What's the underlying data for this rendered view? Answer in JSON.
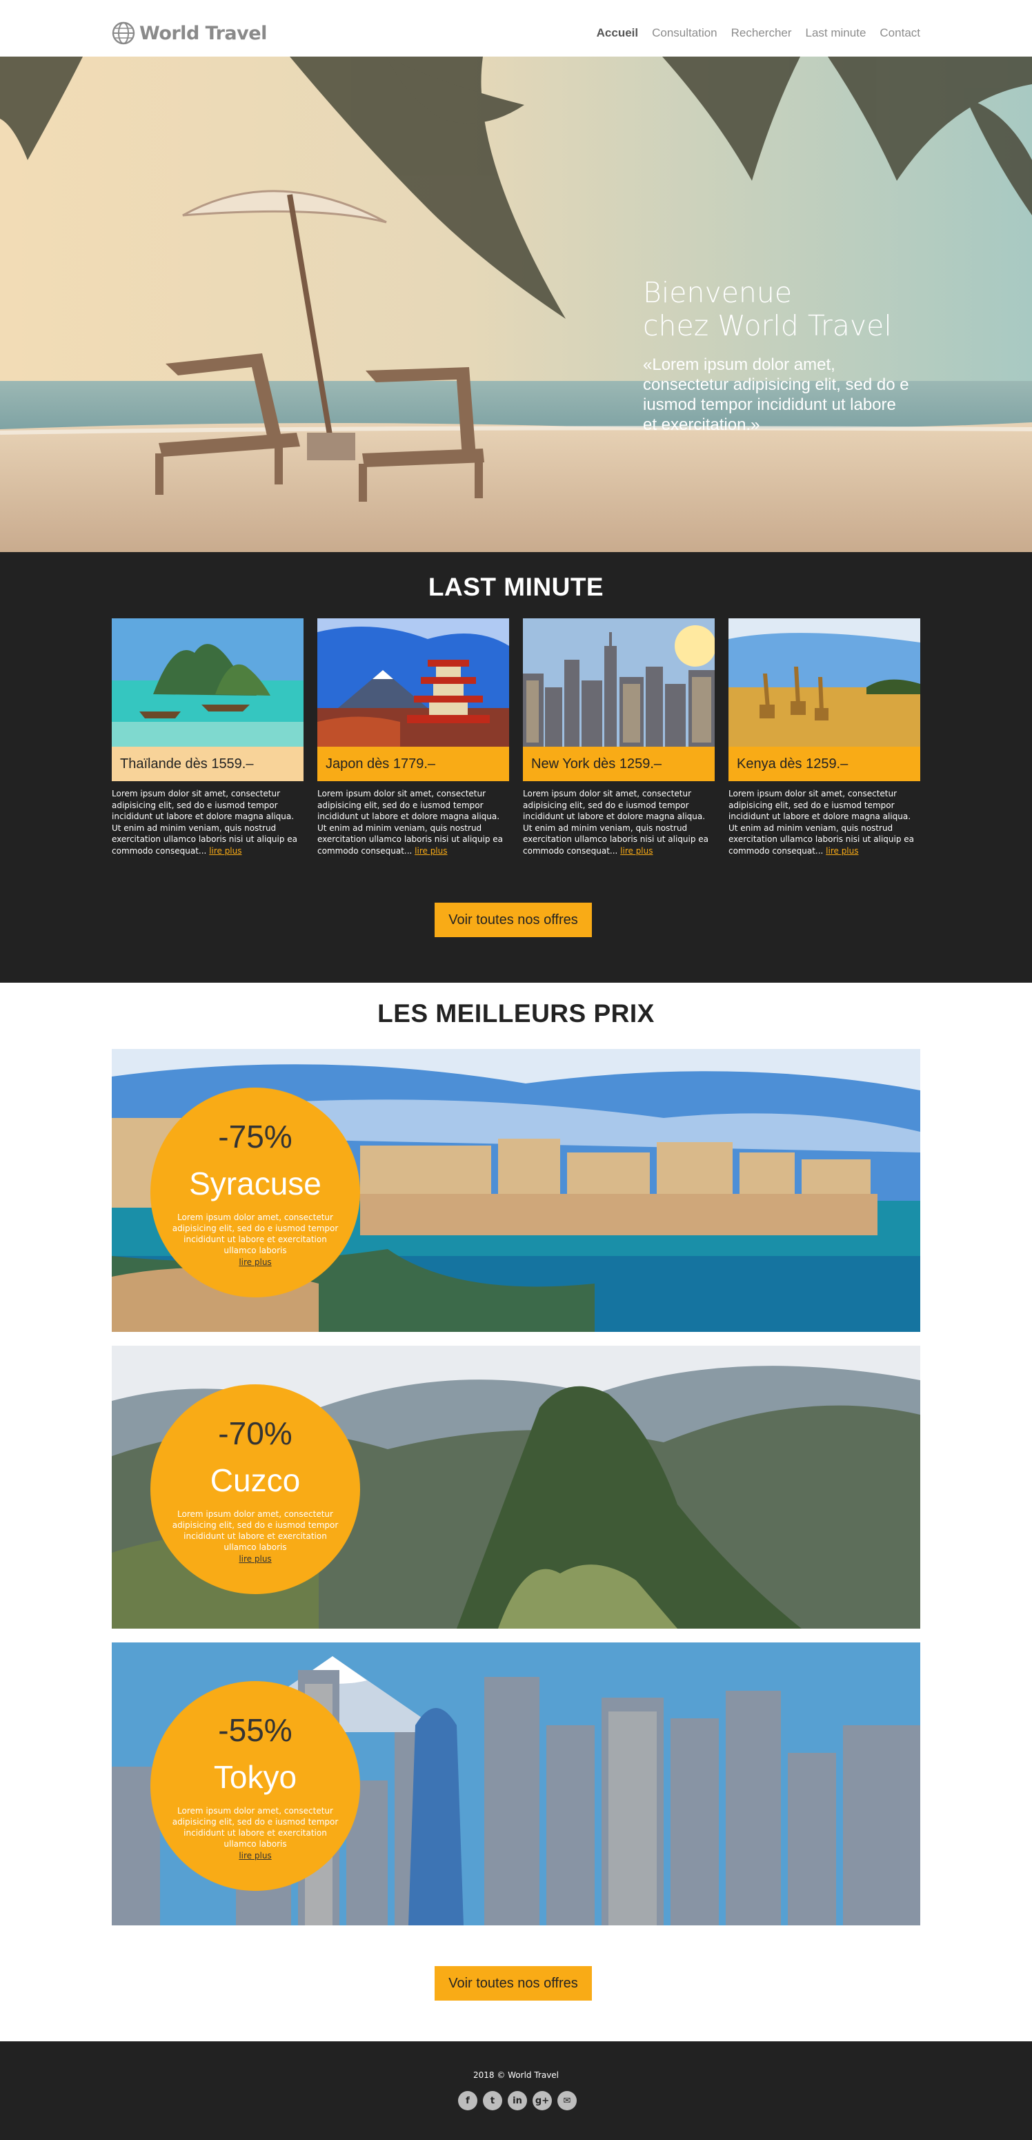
{
  "brand": {
    "name": "World Travel"
  },
  "nav": {
    "items": [
      "Accueil",
      "Consultation",
      "Rechercher",
      "Last minute",
      "Contact"
    ],
    "active": "Accueil"
  },
  "hero": {
    "title_line1": "Bienvenue",
    "title_line2": "chez World Travel",
    "quote": "«Lorem ipsum dolor amet, consectetur adipisicing elit, sed do e iusmod tempor incididunt ut labore et exercitation.»"
  },
  "last_minute": {
    "title": "LAST MINUTE",
    "cards": [
      {
        "caption": "Thaïlande dès 1559.–",
        "text": "Lorem ipsum dolor sit amet, consectetur adipisicing elit, sed do e iusmod tempor incididunt ut labore et dolore magna aliqua. Ut enim ad minim veniam, quis nostrud exercitation ullamco laboris nisi ut aliquip ea commodo consequat... ",
        "more": "lire plus"
      },
      {
        "caption": "Japon dès 1779.–",
        "text": "Lorem ipsum dolor sit amet, consectetur adipisicing elit, sed do e iusmod tempor incididunt ut labore et dolore magna aliqua. Ut enim ad minim veniam, quis nostrud exercitation ullamco laboris nisi ut aliquip ea commodo consequat... ",
        "more": "lire plus"
      },
      {
        "caption": "New York dès 1259.–",
        "text": "Lorem ipsum dolor sit amet, consectetur adipisicing elit, sed do e iusmod tempor incididunt ut labore et dolore magna aliqua. Ut enim ad minim veniam, quis nostrud exercitation ullamco laboris nisi ut aliquip ea commodo consequat... ",
        "more": "lire plus"
      },
      {
        "caption": "Kenya dès 1259.–",
        "text": "Lorem ipsum dolor sit amet, consectetur adipisicing elit, sed do e iusmod tempor incididunt ut labore et dolore magna aliqua. Ut enim ad minim veniam, quis nostrud exercitation ullamco laboris nisi ut aliquip ea commodo consequat... ",
        "more": "lire plus"
      }
    ],
    "button": "Voir toutes nos offres"
  },
  "best_prices": {
    "title": "LES MEILLEURS PRIX",
    "deals": [
      {
        "discount": "-75%",
        "city": "Syracuse",
        "text": "Lorem ipsum dolor amet, consectetur adipisicing elit, sed do e iusmod tempor incididunt ut labore et exercitation ullamco laboris",
        "more": "lire plus"
      },
      {
        "discount": "-70%",
        "city": "Cuzco",
        "text": "Lorem ipsum dolor amet, consectetur adipisicing elit, sed do e iusmod tempor incididunt ut labore et exercitation ullamco laboris",
        "more": "lire plus"
      },
      {
        "discount": "-55%",
        "city": "Tokyo",
        "text": "Lorem ipsum dolor amet, consectetur adipisicing elit, sed do e iusmod tempor incididunt ut labore et exercitation ullamco laboris",
        "more": "lire plus"
      }
    ],
    "button": "Voir toutes nos offres"
  },
  "footer": {
    "copyright": "2018 © World Travel",
    "socials": [
      {
        "icon": "facebook-icon",
        "glyph": "f"
      },
      {
        "icon": "twitter-icon",
        "glyph": "t"
      },
      {
        "icon": "linkedin-icon",
        "glyph": "in"
      },
      {
        "icon": "google-plus-icon",
        "glyph": "g+"
      },
      {
        "icon": "mail-icon",
        "glyph": "✉"
      }
    ]
  },
  "colors": {
    "accent": "#f9ab16",
    "dark": "#222222",
    "nav_text": "#8c8c8c"
  }
}
